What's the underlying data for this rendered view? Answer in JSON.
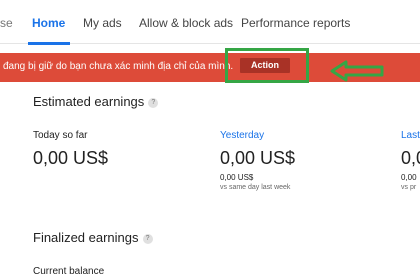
{
  "nav": {
    "partial_item": "se",
    "items": [
      {
        "label": "Home"
      },
      {
        "label": "My ads"
      },
      {
        "label": "Allow & block ads"
      },
      {
        "label": "Performance reports"
      }
    ]
  },
  "alert": {
    "message": "đang bị giữ do bạn chưa xác minh địa chỉ của mình.",
    "action_label": "Action"
  },
  "estimated": {
    "title": "Estimated earnings",
    "help": "?",
    "metrics": [
      {
        "label": "Today so far",
        "value": "0,00 US$",
        "sub": "",
        "note": ""
      },
      {
        "label": "Yesterday",
        "value": "0,00 US$",
        "sub": "0,00 US$",
        "note": "vs same day last week"
      },
      {
        "label": "Last",
        "value": "0,00",
        "sub": "0,00",
        "note": "vs pr"
      }
    ]
  },
  "finalized": {
    "title": "Finalized earnings",
    "help": "?",
    "balance_label": "Current balance"
  },
  "colors": {
    "accent": "#1a73e8",
    "alert_bg": "#dd4b39",
    "highlight": "#35a645"
  }
}
